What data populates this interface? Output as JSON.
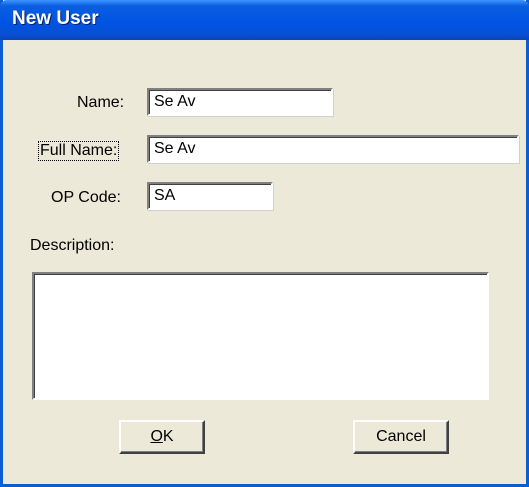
{
  "window": {
    "title": "New User"
  },
  "form": {
    "name_label": "Name:",
    "name_value": "Se Av",
    "fullname_label": "Full Name:",
    "fullname_value": "Se  Av",
    "opcode_label": "OP Code:",
    "opcode_value": "SA",
    "description_label": "Description:",
    "description_value": ""
  },
  "buttons": {
    "ok_mnemonic": "O",
    "ok_rest": "K",
    "cancel_label": "Cancel"
  },
  "colors": {
    "titlebar": "#0054E3",
    "dialog_bg": "#ECE9D8",
    "frame": "#0A5ECF"
  }
}
